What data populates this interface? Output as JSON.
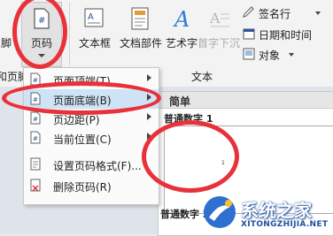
{
  "ribbon": {
    "left_partial_top": "脚",
    "left_partial_bottom": "和页脚",
    "page_number": "页码",
    "text_box": "文本框",
    "doc_parts": "文档部件",
    "wordart": "艺术字",
    "drop_cap": "首字下沉",
    "signature_line": "签名行",
    "date_time": "日期和时间",
    "object": "对象",
    "group_text": "文本"
  },
  "menu": {
    "items": [
      {
        "label": "页面顶端(T)"
      },
      {
        "label": "页面底端(B)"
      },
      {
        "label": "页边距(P)"
      },
      {
        "label": "当前位置(C)"
      },
      {
        "label": "设置页码格式(F)..."
      },
      {
        "label": "删除页码(R)"
      }
    ]
  },
  "submenu": {
    "section": "简单",
    "item1_title": "普通数字 1",
    "item1_preview": "1",
    "item2_title": "普通数字 2"
  },
  "watermark": {
    "title": "系统之家",
    "url": "XITONGZHIJIA.NET"
  },
  "colors": {
    "highlight": "#cfe3f7",
    "ring": "#e8313a",
    "accent": "#2b579a"
  }
}
